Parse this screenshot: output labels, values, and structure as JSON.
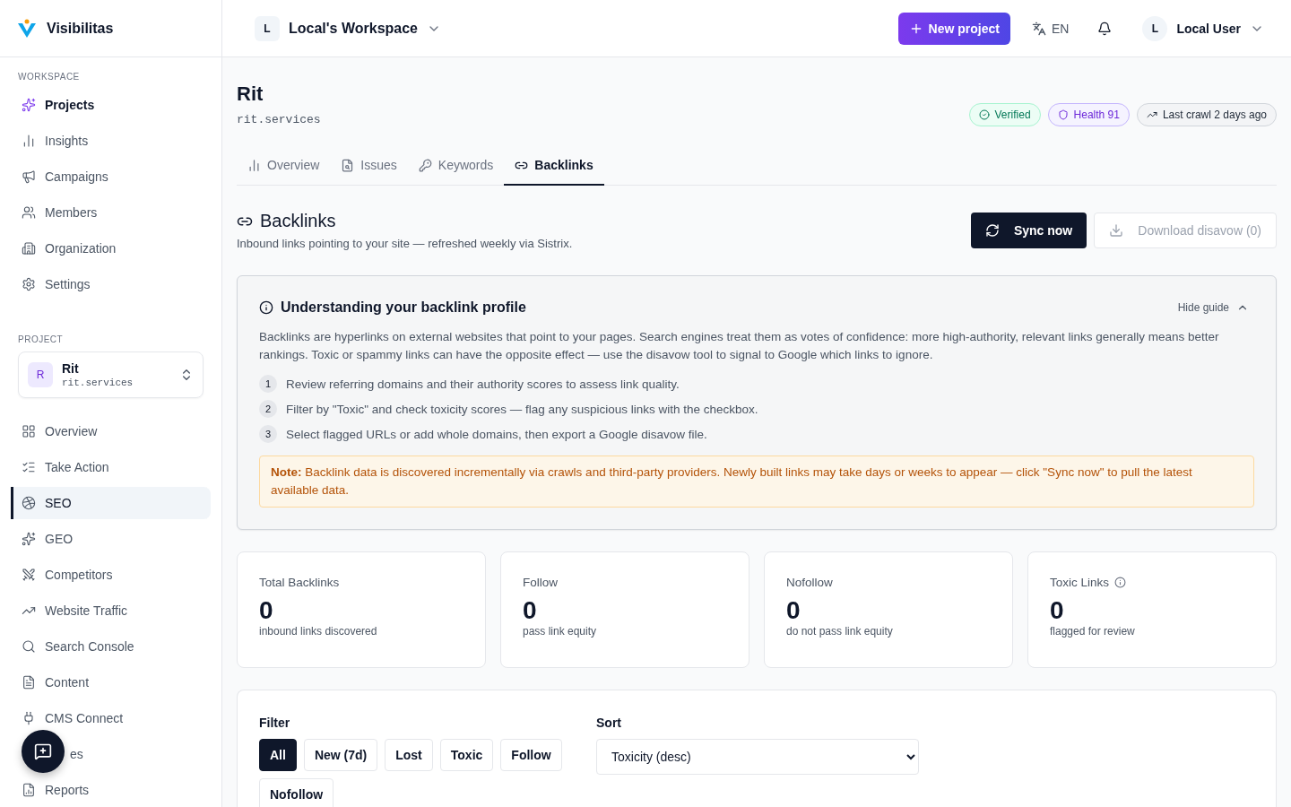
{
  "brand": {
    "name": "Visibilitas"
  },
  "workspace": {
    "initial": "L",
    "name": "Local's Workspace"
  },
  "header": {
    "new_project": "New project",
    "language": "EN",
    "user": {
      "initial": "L",
      "name": "Local User"
    }
  },
  "sidebar": {
    "sections": [
      {
        "title": "WORKSPACE",
        "items": [
          {
            "label": "Projects",
            "selected": false,
            "kind": "accent"
          },
          {
            "label": "Insights",
            "selected": false,
            "kind": "plain"
          },
          {
            "label": "Campaigns",
            "selected": false,
            "kind": "plain"
          },
          {
            "label": "Members",
            "selected": false,
            "kind": "plain"
          },
          {
            "label": "Organization",
            "selected": false,
            "kind": "plain"
          },
          {
            "label": "Settings",
            "selected": false,
            "kind": "plain"
          }
        ]
      },
      {
        "title": "PROJECT",
        "project": {
          "initial": "R",
          "name": "Rit",
          "domain": "rit.services"
        },
        "items": [
          {
            "label": "Overview",
            "selected": false,
            "kind": "plain"
          },
          {
            "label": "Take Action",
            "selected": false,
            "kind": "plain"
          },
          {
            "label": "SEO",
            "selected": true,
            "kind": "plain"
          },
          {
            "label": "GEO",
            "selected": false,
            "kind": "plain"
          },
          {
            "label": "Competitors",
            "selected": false,
            "kind": "plain"
          },
          {
            "label": "Website Traffic",
            "selected": false,
            "kind": "plain"
          },
          {
            "label": "Search Console",
            "selected": false,
            "kind": "plain"
          },
          {
            "label": "Content",
            "selected": false,
            "kind": "plain"
          },
          {
            "label": "CMS Connect",
            "selected": false,
            "kind": "plain"
          },
          {
            "label": "es",
            "selected": false,
            "kind": "covered"
          },
          {
            "label": "Reports",
            "selected": false,
            "kind": "plain"
          }
        ]
      }
    ]
  },
  "project": {
    "name": "Rit",
    "domain": "rit.services",
    "badges": [
      {
        "label": "Verified",
        "kind": "verified"
      },
      {
        "label": "Health 91",
        "kind": "health"
      },
      {
        "label": "Last crawl 2 days ago",
        "kind": "crawl"
      }
    ]
  },
  "tabs": [
    {
      "label": "Overview",
      "selected": false
    },
    {
      "label": "Issues",
      "selected": false
    },
    {
      "label": "Keywords",
      "selected": false
    },
    {
      "label": "Backlinks",
      "selected": true
    }
  ],
  "section": {
    "title": "Backlinks",
    "subtitle": "Inbound links pointing to your site — refreshed weekly via Sistrix.",
    "sync": "Sync now",
    "download": "Download disavow (0)",
    "download_disabled": true
  },
  "guide": {
    "title": "Understanding your backlink profile",
    "toggle": "Hide guide",
    "expanded": true,
    "intro": "Backlinks are hyperlinks on external websites that point to your pages. Search engines treat them as votes of confidence: more high-authority, relevant links generally means better rankings. Toxic or spammy links can have the opposite effect — use the disavow tool to signal to Google which links to ignore.",
    "steps": [
      {
        "number": "1",
        "text": "Review referring domains and their authority scores to assess link quality."
      },
      {
        "number": "2",
        "text": "Filter by \"Toxic\" and check toxicity scores — flag any suspicious links with the checkbox."
      },
      {
        "number": "3",
        "text": "Select flagged URLs or add whole domains, then export a Google disavow file."
      }
    ],
    "note": "**Note:** Backlink data is discovered incrementally via crawls and third-party providers. Newly built links may take days or weeks to appear — click \"Sync now\" to pull the latest available data."
  },
  "stats": [
    {
      "label": "Total Backlinks",
      "value": "0",
      "caption": "inbound links discovered",
      "info": false
    },
    {
      "label": "Follow",
      "value": "0",
      "caption": "pass link equity",
      "info": false
    },
    {
      "label": "Nofollow",
      "value": "0",
      "caption": "do not pass link equity",
      "info": false
    },
    {
      "label": "Toxic Links",
      "value": "0",
      "caption": "flagged for review",
      "info": true
    }
  ],
  "filters": {
    "label": "Filter",
    "chips": [
      {
        "label": "All",
        "selected": true
      },
      {
        "label": "New (7d)",
        "selected": false
      },
      {
        "label": "Lost",
        "selected": false
      },
      {
        "label": "Toxic",
        "selected": false
      },
      {
        "label": "Follow",
        "selected": false
      },
      {
        "label": "Nofollow",
        "selected": false
      }
    ]
  },
  "sort": {
    "label": "Sort",
    "value": "Toxicity (desc)"
  }
}
